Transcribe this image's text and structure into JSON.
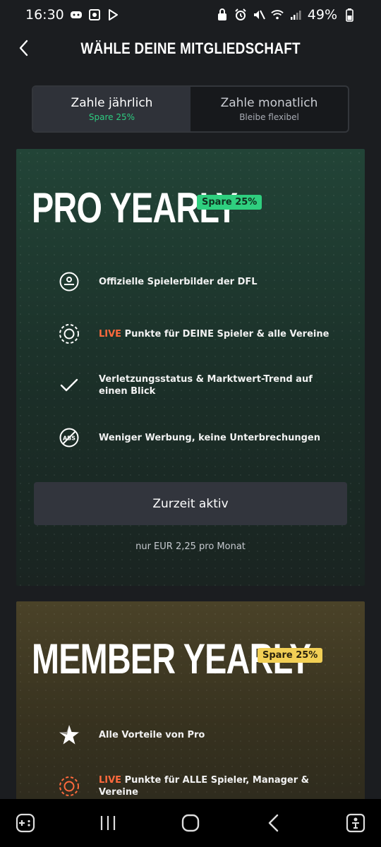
{
  "status_bar": {
    "time": "16:30",
    "battery": "49%"
  },
  "header": {
    "title": "WÄHLE DEINE MITGLIEDSCHAFT"
  },
  "billing_toggle": {
    "yearly": {
      "label": "Zahle jährlich",
      "sub": "Spare 25%",
      "selected": true
    },
    "monthly": {
      "label": "Zahle monatlich",
      "sub": "Bleibe flexibel",
      "selected": false
    }
  },
  "plans": {
    "pro": {
      "title": "PRO YEARLY",
      "badge": "Spare 25%",
      "features": [
        {
          "icon": "player-card-icon",
          "text": "Offizielle Spielerbilder der DFL"
        },
        {
          "icon": "live-points-icon",
          "live": "LIVE",
          "text": " Punkte für DEINE Spieler & alle Vereine"
        },
        {
          "icon": "check-icon",
          "text": "Verletzungsstatus & Marktwert-Trend auf einen Blick"
        },
        {
          "icon": "no-ads-icon",
          "text": "Weniger Werbung, keine Unterbrechungen"
        }
      ],
      "cta_label": "Zurzeit aktiv",
      "price_note": "nur EUR 2,25 pro Monat",
      "colors": {
        "badge": "#2fcf7f",
        "live": "#ff6a3d"
      }
    },
    "member": {
      "title": "MEMBER YEARLY",
      "badge": "Spare 25%",
      "features": [
        {
          "icon": "star-icon",
          "text": "Alle Vorteile von Pro"
        },
        {
          "icon": "live-points-icon",
          "live": "LIVE",
          "text": " Punkte für ALLE Spieler, Manager & Vereine"
        }
      ],
      "colors": {
        "badge": "#f2cf55",
        "live": "#ff6a3d"
      }
    }
  },
  "nav_bar": {
    "buttons": [
      "game-launcher-icon",
      "recent-apps-icon",
      "home-icon",
      "back-icon",
      "accessibility-icon"
    ]
  }
}
